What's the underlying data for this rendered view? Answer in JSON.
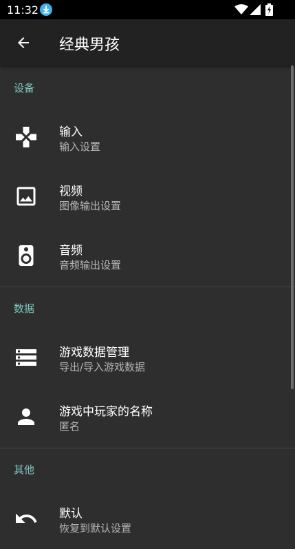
{
  "status_bar": {
    "time": "11:32"
  },
  "app_bar": {
    "title": "经典男孩"
  },
  "sections": [
    {
      "header": "设备"
    },
    {
      "header": "数据"
    },
    {
      "header": "其他"
    }
  ],
  "items": [
    {
      "icon": "gamepad-icon",
      "title": "输入",
      "summary": "输入设置"
    },
    {
      "icon": "image-icon",
      "title": "视频",
      "summary": "图像输出设置"
    },
    {
      "icon": "speaker-icon",
      "title": "音频",
      "summary": "音频输出设置"
    },
    {
      "icon": "storage-icon",
      "title": "游戏数据管理",
      "summary": "导出/导入游戏数据"
    },
    {
      "icon": "person-icon",
      "title": "游戏中玩家的名称",
      "summary": "匿名"
    },
    {
      "icon": "undo-icon",
      "title": "默认",
      "summary": "恢复到默认设置"
    }
  ]
}
